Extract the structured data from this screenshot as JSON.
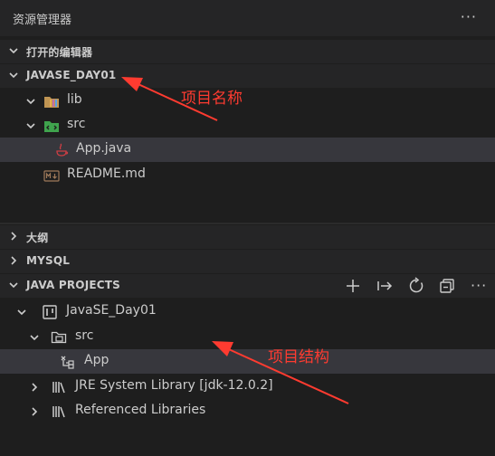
{
  "explorer": {
    "title": "资源管理器",
    "more": "···"
  },
  "open_editors": {
    "label": "打开的编辑器"
  },
  "project": {
    "label": "JAVASE_DAY01",
    "items": [
      {
        "label": "lib",
        "icon": "library-folder-icon"
      },
      {
        "label": "src",
        "icon": "source-folder-icon"
      },
      {
        "label": "App.java",
        "icon": "java-file-icon"
      },
      {
        "label": "README.md",
        "icon": "markdown-file-icon"
      }
    ]
  },
  "outline": {
    "label": "大纲"
  },
  "mysql": {
    "label": "MYSQL"
  },
  "java_projects": {
    "label": "JAVA PROJECTS",
    "actions": [
      "add-icon",
      "link-icon",
      "refresh-icon",
      "collapse-all-icon",
      "more-icon"
    ],
    "more": "···",
    "items": [
      {
        "label": "JavaSE_Day01",
        "icon": "project-icon"
      },
      {
        "label": "src",
        "icon": "package-folder-icon"
      },
      {
        "label": "App",
        "icon": "class-icon"
      },
      {
        "label": "JRE System Library [jdk-12.0.2]",
        "icon": "library-icon"
      },
      {
        "label": "Referenced Libraries",
        "icon": "library-icon"
      }
    ]
  },
  "annotations": {
    "project_name": "项目名称",
    "project_structure": "项目结构"
  },
  "colors": {
    "background": "#1e1e1e",
    "header": "#252526",
    "selection": "#37373d",
    "annotation": "#ff3b30"
  }
}
